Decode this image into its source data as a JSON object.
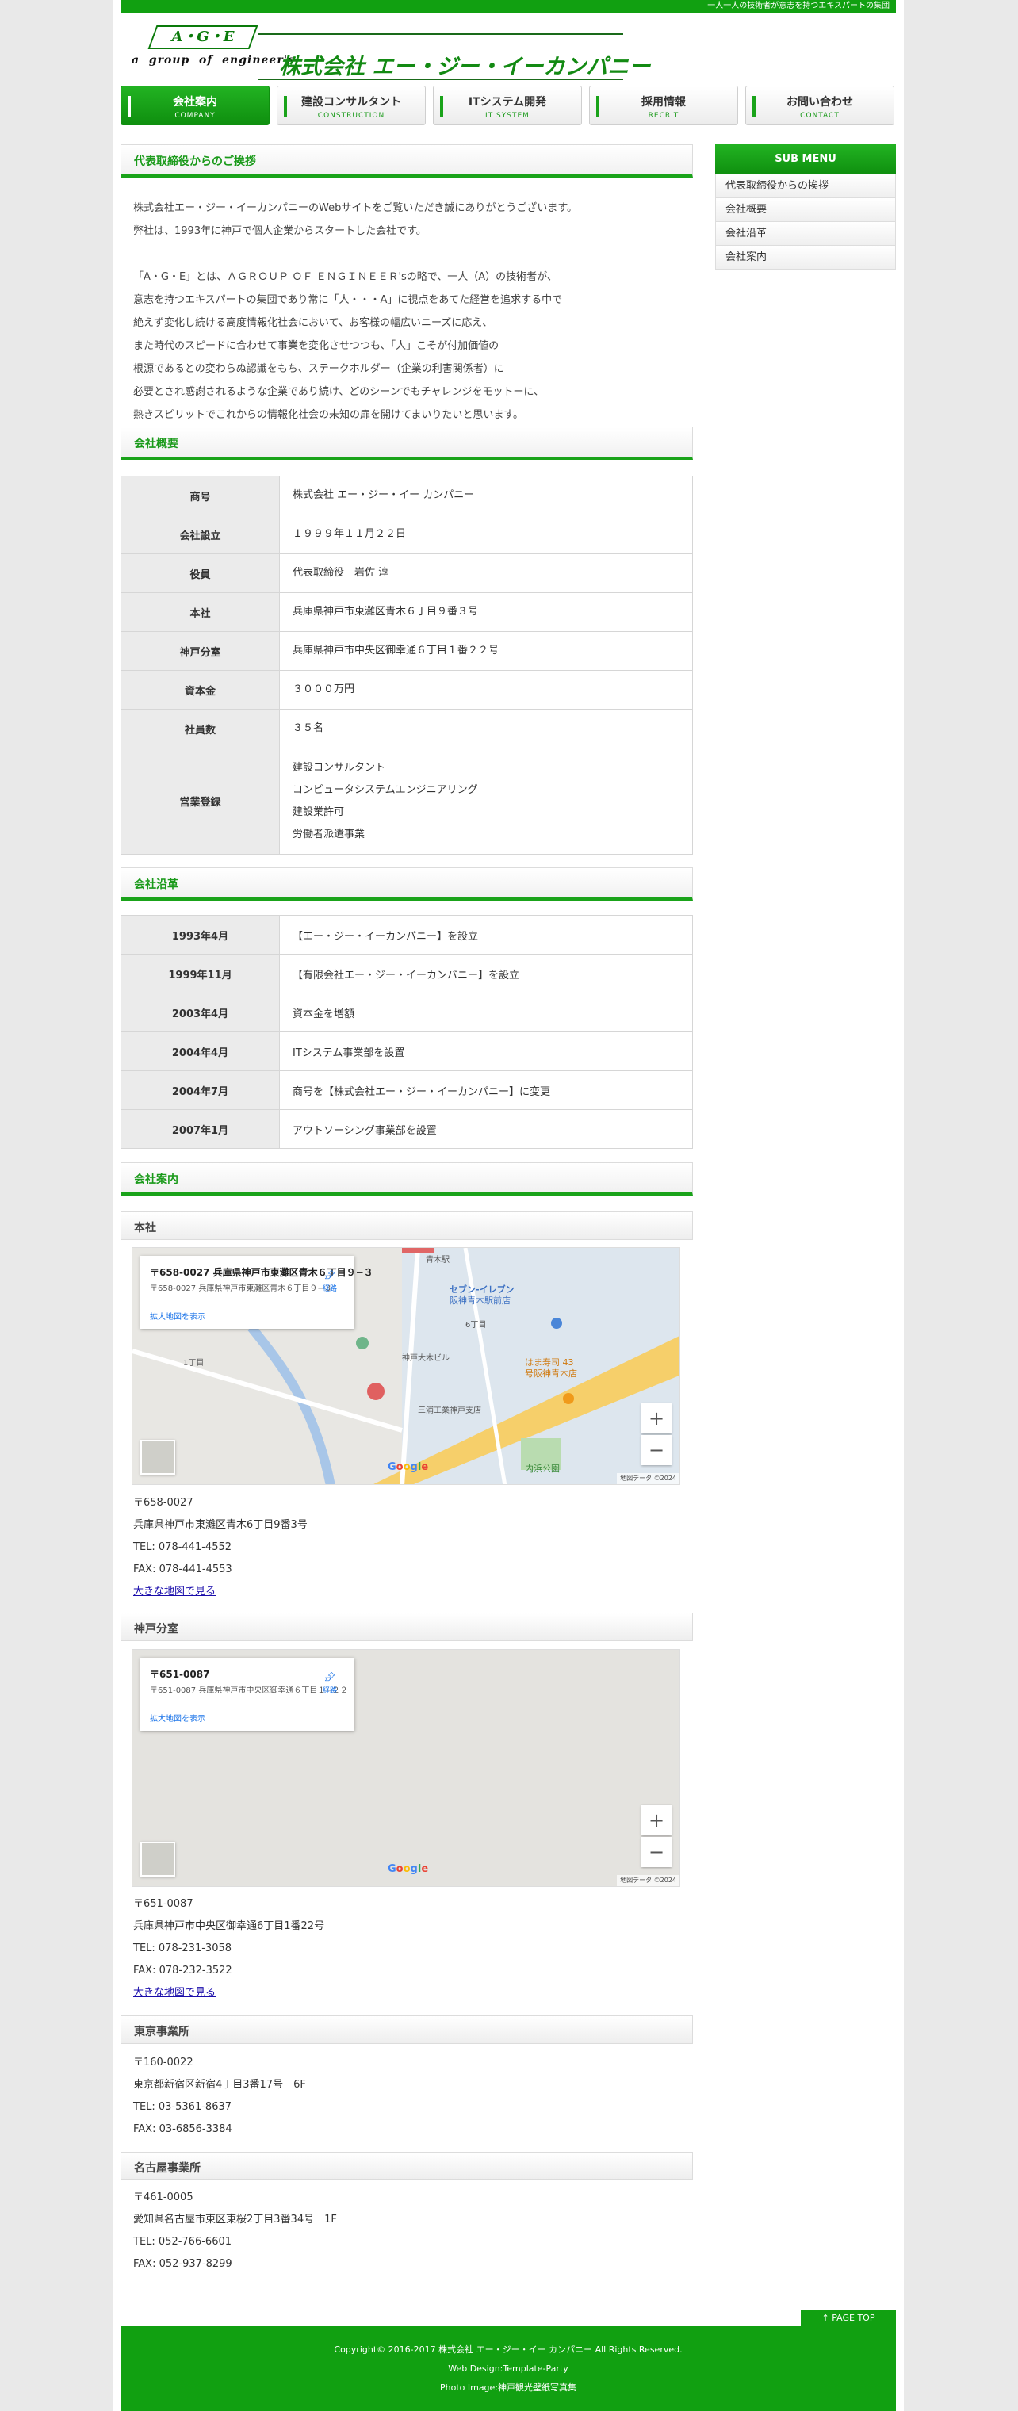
{
  "topbar": {
    "tagline": "一人一人の技術者が意志を持つエキスパートの集団"
  },
  "logo": {
    "mark": "A・G・E",
    "sub": "a  group  of  engineer's",
    "name": "株式会社 エー・ジー・イーカンパニー"
  },
  "nav": [
    {
      "label": "会社案内",
      "sub": "COMPANY"
    },
    {
      "label": "建設コンサルタント",
      "sub": "CONSTRUCTION"
    },
    {
      "label": "ITシステム開発",
      "sub": "IT SYSTEM"
    },
    {
      "label": "採用情報",
      "sub": "RECRIT"
    },
    {
      "label": "お問い合わせ",
      "sub": "CONTACT"
    }
  ],
  "greeting": {
    "heading": "代表取締役からのご挨拶",
    "lines": [
      "株式会社エー・ジー・イーカンパニーのWebサイトをご覧いただき誠にありがとうございます。",
      "弊社は、1993年に神戸で個人企業からスタートした会社です。",
      "",
      "「A・G・E」とは、ＡＧＲＯＵＰ ＯＦ ＥＮＧＩＮＥＥＲ'sの略で、一人（A）の技術者が、",
      "意志を持つエキスパートの集団であり常に「人・・・A」に視点をあてた経営を追求する中で",
      "絶えず変化し続ける高度情報化社会において、お客様の幅広いニーズに応え、",
      "また時代のスピードに合わせて事業を変化させつつも、「人」こそが付加価値の",
      "根源であるとの変わらぬ認識をもち、ステークホルダー（企業の利害関係者）に",
      "必要とされ感謝されるような企業であり続け、どのシーンでもチャレンジをモットーに、",
      "熱きスピリットでこれからの情報化社会の未知の扉を開けてまいりたいと思います。"
    ]
  },
  "overview": {
    "heading": "会社概要",
    "rows": [
      {
        "k": "商号",
        "v": [
          "株式会社 エー・ジー・イー カンパニー"
        ]
      },
      {
        "k": "会社設立",
        "v": [
          "１９９９年１１月２２日"
        ]
      },
      {
        "k": "役員",
        "v": [
          "代表取締役　岩佐 淳"
        ]
      },
      {
        "k": "本社",
        "v": [
          "兵庫県神戸市東灘区青木６丁目９番３号"
        ]
      },
      {
        "k": "神戸分室",
        "v": [
          "兵庫県神戸市中央区御幸通６丁目１番２２号"
        ]
      },
      {
        "k": "資本金",
        "v": [
          "３０００万円"
        ]
      },
      {
        "k": "社員数",
        "v": [
          "３５名"
        ]
      },
      {
        "k": "営業登録",
        "v": [
          "建設コンサルタント",
          "コンピュータシステムエンジニアリング",
          "建設業許可",
          "労働者派遣事業"
        ]
      }
    ]
  },
  "history": {
    "heading": "会社沿革",
    "rows": [
      {
        "k": "1993年4月",
        "v": "【エー・ジー・イーカンパニー】を設立"
      },
      {
        "k": "1999年11月",
        "v": "【有限会社エー・ジー・イーカンパニー】を設立"
      },
      {
        "k": "2003年4月",
        "v": "資本金を増額"
      },
      {
        "k": "2004年4月",
        "v": "ITシステム事業部を設置"
      },
      {
        "k": "2004年7月",
        "v": "商号を【株式会社エー・ジー・イーカンパニー】に変更"
      },
      {
        "k": "2007年1月",
        "v": "アウトソーシング事業部を設置"
      }
    ]
  },
  "offices": {
    "heading": "会社案内",
    "hq": {
      "title": "本社",
      "map_card_title": "〒658-0027 兵庫県神戸市東灘区青木６丁目９−３",
      "map_card_addr": "〒658-0027 兵庫県神戸市東灘区青木６丁目９−３",
      "map_card_link": "拡大地図を表示",
      "map_labels": [
        "青木駅",
        "セブン-イレブン",
        "阪神青木駅前店",
        "6丁目",
        "はま寿司 43",
        "号阪神青木店",
        "神戸大木ビル",
        "三浦工業神戸支店",
        "内浜公園",
        "1丁目"
      ],
      "zip": "〒658-0027",
      "addr": "兵庫県神戸市東灘区青木6丁目9番3号",
      "tel": "TEL: 078-441-4552",
      "fax": "FAX: 078-441-4553",
      "link": "大きな地図で見る"
    },
    "kobe": {
      "title": "神戸分室",
      "map_card_title": "〒651-0087",
      "map_card_addr": "〒651-0087 兵庫県神戸市中央区御幸通６丁目１−２２",
      "map_card_link": "拡大地図を表示",
      "zip": "〒651-0087",
      "addr": "兵庫県神戸市中央区御幸通6丁目1番22号",
      "tel": "TEL: 078-231-3058",
      "fax": "FAX: 078-232-3522",
      "link": "大きな地図で見る"
    },
    "tokyo": {
      "title": "東京事業所",
      "zip": "〒160-0022",
      "addr": "東京都新宿区新宿4丁目3番17号　6F",
      "tel": "TEL: 03-5361-8637",
      "fax": "FAX: 03-6856-3384"
    },
    "nagoya": {
      "title": "名古屋事業所",
      "zip": "〒461-0005",
      "addr": "愛知県名古屋市東区東桜2丁目3番34号　1F",
      "tel": "TEL: 052-766-6601",
      "fax": "FAX: 052-937-8299"
    },
    "map_attrib": "地図データ ©2024",
    "map_route": "経路",
    "google": "Google"
  },
  "sidebar": {
    "title": "SUB MENU",
    "items": [
      "代表取締役からの挨拶",
      "会社概要",
      "会社沿革",
      "会社案内"
    ]
  },
  "footer": {
    "pagetop": "↑ PAGE TOP",
    "copyright": "Copyright© 2016-2017 株式会社 エー・ジー・イー カンパニー All Rights Reserved.",
    "design": "Web Design:Template-Party",
    "photo": "Photo Image:神戸観光壁紙写真集"
  },
  "colors": {
    "brand": "#11a011",
    "link": "#1a0dab"
  }
}
